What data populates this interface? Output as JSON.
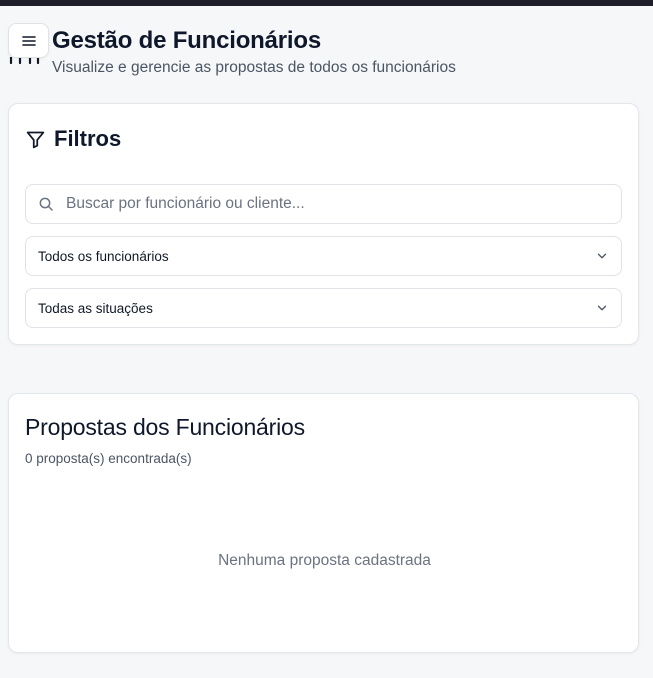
{
  "header": {
    "title": "Gestão de Funcionários",
    "subtitle": "Visualize e gerencie as propostas de todos os funcionários",
    "menu_icon": "hamburger-menu-icon"
  },
  "filters": {
    "title": "Filtros",
    "icon": "filter-icon",
    "search": {
      "placeholder": "Buscar por funcionário ou cliente...",
      "value": "",
      "icon": "search-icon"
    },
    "employee_select": {
      "selected": "Todos os funcionários",
      "icon": "chevron-down-icon"
    },
    "status_select": {
      "selected": "Todas as situações",
      "icon": "chevron-down-icon"
    }
  },
  "proposals": {
    "title": "Propostas dos Funcionários",
    "count_text": "0 proposta(s) encontrada(s)",
    "empty_message": "Nenhuma proposta cadastrada"
  },
  "colors": {
    "background": "#f6f7f9",
    "card": "#ffffff",
    "border": "#e3e6ea",
    "title": "#0f172a",
    "muted": "#4b5563",
    "topbar": "#1e1e2a"
  }
}
